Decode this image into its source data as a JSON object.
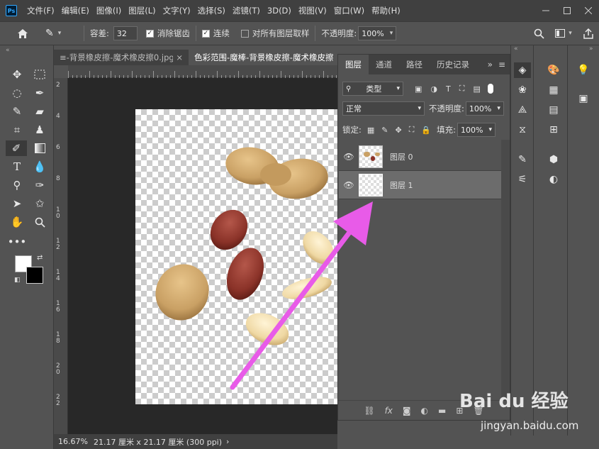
{
  "menubar": {
    "logo": "Ps",
    "items": [
      "文件(F)",
      "编辑(E)",
      "图像(I)",
      "图层(L)",
      "文字(Y)",
      "选择(S)",
      "滤镜(T)",
      "3D(D)",
      "视图(V)",
      "窗口(W)",
      "帮助(H)"
    ]
  },
  "options": {
    "tolerance_label": "容差:",
    "tolerance_value": "32",
    "antialias_label": "消除锯齿",
    "contiguous_label": "连续",
    "sample_all_label": "对所有图层取样",
    "opacity_label": "不透明度:",
    "opacity_value": "100%"
  },
  "tabs": [
    {
      "label": "≡-背景橡皮擦-魔术橡皮擦0.jpg"
    },
    {
      "label": "色彩范围-魔棒-背景橡皮擦-魔术橡皮擦"
    }
  ],
  "ruler_left": [
    "2",
    "4",
    "6",
    "8",
    "1\n0",
    "1\n2",
    "1\n4",
    "1\n6",
    "1\n8",
    "2\n0",
    "2\n2"
  ],
  "status": {
    "zoom": "16.67%",
    "doc_info": "21.17 厘米 x 21.17 厘米 (300 ppi)"
  },
  "layers_panel": {
    "tabs": [
      "图层",
      "通道",
      "路径",
      "历史记录"
    ],
    "filter_kind": "类型",
    "blend_mode": "正常",
    "opacity_label": "不透明度:",
    "opacity_value": "100%",
    "lock_label": "锁定:",
    "fill_label": "填充:",
    "fill_value": "100%",
    "layers": [
      {
        "name": "图层 0",
        "selected": false
      },
      {
        "name": "图层 1",
        "selected": true
      }
    ]
  },
  "colors": {
    "arrow": "#e85be8",
    "accent": "#31a8ff",
    "foreground": "#ffffff",
    "background": "#000000"
  },
  "watermark": {
    "brand": "Bai du 经验",
    "url": "jingyan.baidu.com"
  }
}
